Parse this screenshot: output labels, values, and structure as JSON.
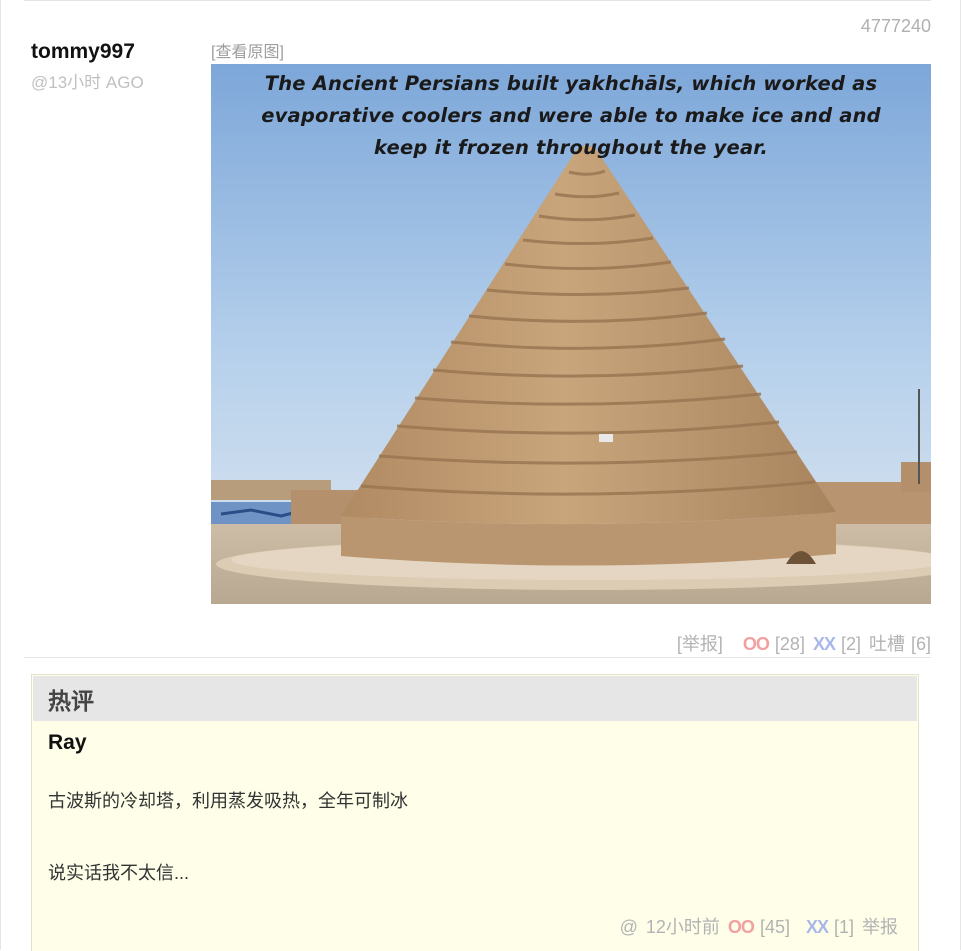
{
  "post": {
    "id": "4777240",
    "author": "tommy997",
    "time": "@13小时 AGO",
    "view_original": "[查看原图]",
    "image_caption": [
      "The Ancient Persians built yakhchāls, which worked as",
      "evaporative coolers and were able to make ice and and",
      "keep it frozen throughout the year."
    ],
    "actions": {
      "report": "[举报]",
      "oo": "OO",
      "oo_count": "[28]",
      "xx": "XX",
      "xx_count": "[2]",
      "tucao": "吐槽",
      "tucao_count": "[6]"
    }
  },
  "hot_comments": {
    "title": "热评",
    "comment": {
      "author": "Ray",
      "line1": "古波斯的冷却塔，利用蒸发吸热，全年可制冰",
      "line2": "说实话我不太信...",
      "at": "@",
      "time": "12小时前",
      "oo": "OO",
      "oo_count": "[45]",
      "xx": "XX",
      "xx_count": "[1]",
      "report": "举报"
    }
  },
  "colors": {
    "oo": "#f2a0a0",
    "xx": "#a9b8e8",
    "muted": "#b3b3b3",
    "comment_bg": "#fefee9"
  }
}
